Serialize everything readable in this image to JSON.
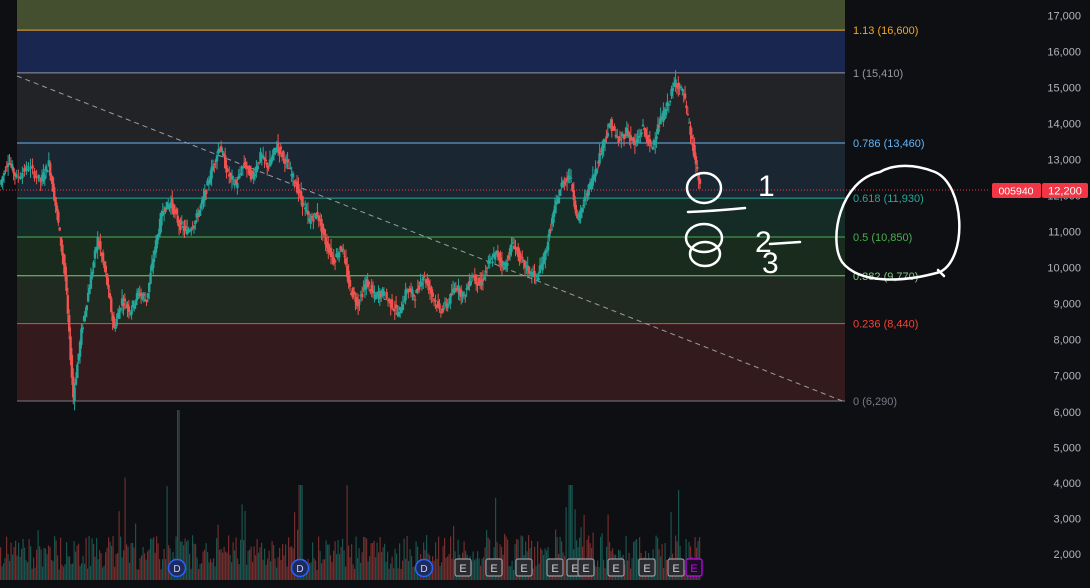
{
  "chart_data": {
    "type": "candlestick",
    "symbol_badge": "005940",
    "price_badge": "12,200",
    "y_axis": {
      "range": [
        6000,
        17000
      ],
      "price_ticks": [
        "7,000",
        "8,000",
        "9,000",
        "10,000",
        "11,000",
        "12,000",
        "13,000",
        "14,000",
        "15,000",
        "16,000",
        "17,000"
      ],
      "price_tick_values": [
        7000,
        8000,
        9000,
        10000,
        11000,
        12000,
        13000,
        14000,
        15000,
        16000,
        17000
      ],
      "volume_ticks": [
        "2,000",
        "3,000",
        "4,000",
        "5,000",
        "6,000"
      ],
      "volume_tick_values": [
        2000,
        3000,
        4000,
        5000,
        6000
      ]
    },
    "fibonacci_levels": [
      {
        "label": "1.13 (16,600)",
        "ratio": 1.13,
        "price": 16600,
        "color": "#f5a623"
      },
      {
        "label": "1 (15,410)",
        "ratio": 1,
        "price": 15410,
        "color": "#9598a1"
      },
      {
        "label": "0.786 (13,460)",
        "ratio": 0.786,
        "price": 13460,
        "color": "#64b5f6"
      },
      {
        "label": "0.618 (11,930)",
        "ratio": 0.618,
        "price": 11930,
        "color": "#26a69a"
      },
      {
        "label": "0.5 (10,850)",
        "ratio": 0.5,
        "price": 10850,
        "color": "#4caf50"
      },
      {
        "label": "0.382 (9,770)",
        "ratio": 0.382,
        "price": 9770,
        "color": "#81c784"
      },
      {
        "label": "0.236 (8,440)",
        "ratio": 0.236,
        "price": 8440,
        "color": "#f44336"
      },
      {
        "label": "0 (6,290)",
        "ratio": 0,
        "price": 6290,
        "color": "#787b86"
      }
    ],
    "zones": [
      {
        "from": 16600,
        "to": 17450,
        "color": "#4c5a34"
      },
      {
        "from": 15410,
        "to": 16600,
        "color": "#1a2a5c"
      },
      {
        "from": 13460,
        "to": 15410,
        "color": "#26272b"
      },
      {
        "from": 11930,
        "to": 13460,
        "color": "#1c2b3a"
      },
      {
        "from": 10850,
        "to": 11930,
        "color": "#15302a"
      },
      {
        "from": 9770,
        "to": 10850,
        "color": "#1a3020"
      },
      {
        "from": 8440,
        "to": 9770,
        "color": "#252f25"
      },
      {
        "from": 6290,
        "to": 8440,
        "color": "#3a1c20"
      }
    ],
    "price_path": [
      [
        0,
        12300
      ],
      [
        0.01,
        13000
      ],
      [
        0.02,
        12500
      ],
      [
        0.035,
        12800
      ],
      [
        0.05,
        12400
      ],
      [
        0.06,
        12900
      ],
      [
        0.07,
        11500
      ],
      [
        0.08,
        9800
      ],
      [
        0.09,
        6400
      ],
      [
        0.1,
        8200
      ],
      [
        0.11,
        9500
      ],
      [
        0.12,
        10800
      ],
      [
        0.13,
        9800
      ],
      [
        0.14,
        8300
      ],
      [
        0.15,
        9100
      ],
      [
        0.16,
        8800
      ],
      [
        0.17,
        9300
      ],
      [
        0.18,
        9100
      ],
      [
        0.19,
        10500
      ],
      [
        0.2,
        11600
      ],
      [
        0.21,
        11800
      ],
      [
        0.22,
        11200
      ],
      [
        0.23,
        11000
      ],
      [
        0.24,
        11300
      ],
      [
        0.25,
        11900
      ],
      [
        0.26,
        12700
      ],
      [
        0.27,
        13400
      ],
      [
        0.28,
        12600
      ],
      [
        0.29,
        12300
      ],
      [
        0.3,
        12900
      ],
      [
        0.31,
        12500
      ],
      [
        0.32,
        13100
      ],
      [
        0.33,
        12800
      ],
      [
        0.34,
        13400
      ],
      [
        0.35,
        13000
      ],
      [
        0.36,
        12500
      ],
      [
        0.37,
        11900
      ],
      [
        0.38,
        11300
      ],
      [
        0.39,
        11500
      ],
      [
        0.4,
        10700
      ],
      [
        0.41,
        10200
      ],
      [
        0.42,
        10600
      ],
      [
        0.43,
        9400
      ],
      [
        0.44,
        9000
      ],
      [
        0.45,
        9600
      ],
      [
        0.46,
        9200
      ],
      [
        0.47,
        9300
      ],
      [
        0.48,
        9000
      ],
      [
        0.49,
        8700
      ],
      [
        0.5,
        9400
      ],
      [
        0.51,
        9200
      ],
      [
        0.52,
        9800
      ],
      [
        0.53,
        9300
      ],
      [
        0.54,
        8800
      ],
      [
        0.55,
        9000
      ],
      [
        0.56,
        9500
      ],
      [
        0.57,
        9200
      ],
      [
        0.58,
        9800
      ],
      [
        0.59,
        9500
      ],
      [
        0.6,
        10100
      ],
      [
        0.61,
        10400
      ],
      [
        0.62,
        10000
      ],
      [
        0.63,
        10700
      ],
      [
        0.64,
        10200
      ],
      [
        0.65,
        9900
      ],
      [
        0.66,
        9700
      ],
      [
        0.67,
        10400
      ],
      [
        0.68,
        11500
      ],
      [
        0.69,
        12300
      ],
      [
        0.7,
        12600
      ],
      [
        0.71,
        11300
      ],
      [
        0.72,
        12000
      ],
      [
        0.73,
        12600
      ],
      [
        0.74,
        13400
      ],
      [
        0.75,
        14000
      ],
      [
        0.76,
        13500
      ],
      [
        0.77,
        13800
      ],
      [
        0.78,
        13400
      ],
      [
        0.79,
        13900
      ],
      [
        0.8,
        13300
      ],
      [
        0.81,
        14000
      ],
      [
        0.82,
        14500
      ],
      [
        0.83,
        15200
      ],
      [
        0.84,
        14800
      ],
      [
        0.85,
        13500
      ],
      [
        0.86,
        12200
      ]
    ],
    "event_markers": [
      "D",
      "D",
      "D",
      "E",
      "E",
      "E",
      "E",
      "E",
      "E",
      "E",
      "E",
      "E",
      "E"
    ],
    "annotations": {
      "numbers": [
        "1",
        "2",
        "3"
      ]
    }
  }
}
